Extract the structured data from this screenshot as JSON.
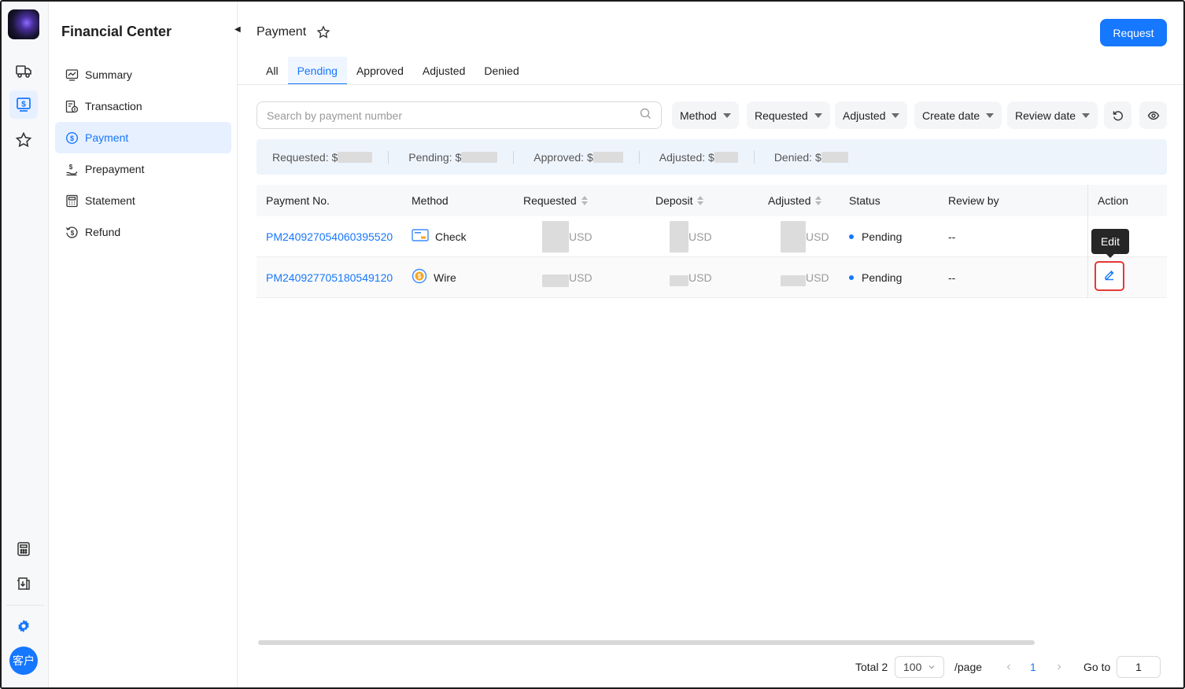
{
  "app": {
    "section_title": "Financial Center"
  },
  "rail": {
    "items": [
      "truck-icon",
      "finance-icon",
      "star-icon",
      "calculator-icon",
      "invoice-download-icon",
      "settings-gear-icon"
    ],
    "avatar_text": "客户"
  },
  "sidebar": {
    "items": [
      {
        "label": "Summary",
        "icon": "chart-line-icon"
      },
      {
        "label": "Transaction",
        "icon": "transaction-icon"
      },
      {
        "label": "Payment",
        "icon": "dollar-circle-icon",
        "active": true
      },
      {
        "label": "Prepayment",
        "icon": "hand-money-icon"
      },
      {
        "label": "Statement",
        "icon": "statement-icon"
      },
      {
        "label": "Refund",
        "icon": "refund-icon"
      }
    ]
  },
  "header": {
    "title": "Payment",
    "request_label": "Request"
  },
  "tabs": [
    "All",
    "Pending",
    "Approved",
    "Adjusted",
    "Denied"
  ],
  "active_tab": "Pending",
  "filters": {
    "search_placeholder": "Search by payment number",
    "method": "Method",
    "requested": "Requested",
    "adjusted": "Adjusted",
    "create_date": "Create date",
    "review_date": "Review date"
  },
  "summary": {
    "requested": "Requested: $",
    "pending": "Pending: $",
    "approved": "Approved: $",
    "adjusted": "Adjusted: $",
    "denied": "Denied: $"
  },
  "table": {
    "columns": {
      "payment_no": "Payment No.",
      "method": "Method",
      "requested": "Requested",
      "deposit": "Deposit",
      "adjusted": "Adjusted",
      "status": "Status",
      "review_by": "Review by",
      "action": "Action"
    },
    "rows": [
      {
        "payment_no": "PM240927054060395520",
        "method": "Check",
        "method_icon": "check-icon",
        "currency": "USD",
        "status": "Pending",
        "review_by": "--"
      },
      {
        "payment_no": "PM240927705180549120",
        "method": "Wire",
        "method_icon": "wire-coin-icon",
        "currency": "USD",
        "status": "Pending",
        "review_by": "--"
      }
    ],
    "tooltip": "Edit"
  },
  "pagination": {
    "total": "Total 2",
    "page_size": "100",
    "per_page": "/page",
    "current_page": "1",
    "goto_label": "Go to",
    "goto_value": "1"
  },
  "colors": {
    "accent": "#1677ff",
    "highlight_border": "#e53935",
    "summary_bg": "#eef4fc"
  }
}
